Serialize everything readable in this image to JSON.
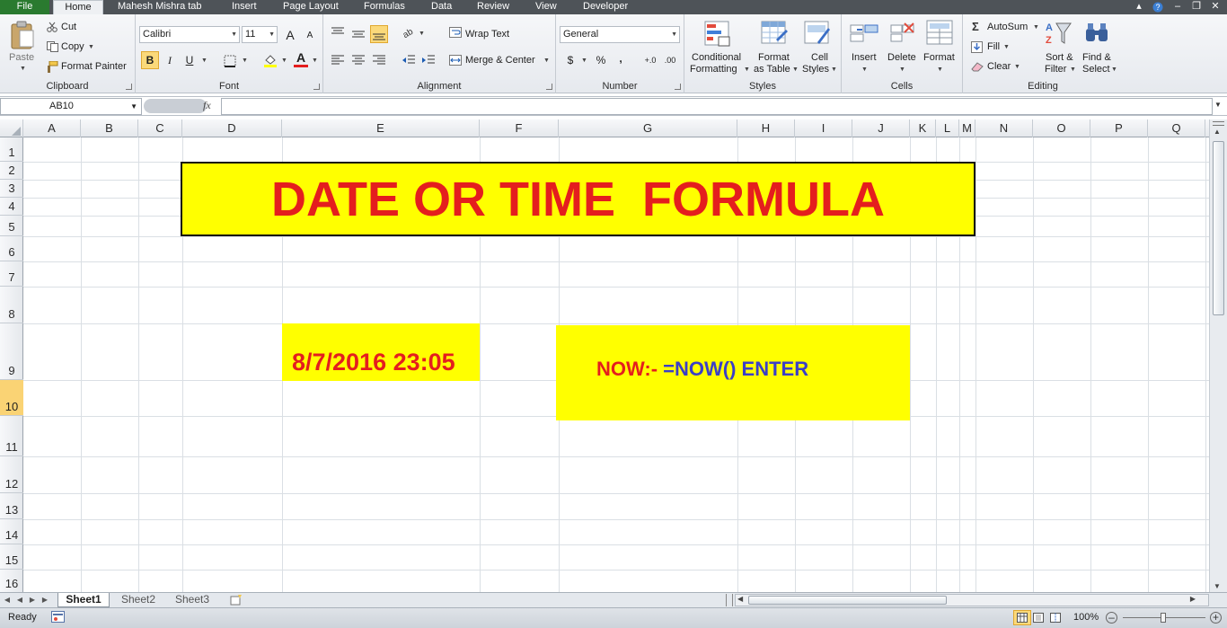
{
  "ribbon_tabs": [
    "File",
    "Home",
    "Mahesh Mishra tab",
    "Insert",
    "Page Layout",
    "Formulas",
    "Data",
    "Review",
    "View",
    "Developer"
  ],
  "clipboard": {
    "paste": "Paste",
    "cut": "Cut",
    "copy": "Copy",
    "format_painter": "Format Painter",
    "label": "Clipboard"
  },
  "font": {
    "name": "Calibri",
    "size": "11",
    "bold": "B",
    "italic": "I",
    "underline": "U",
    "grow": "A",
    "shrink": "A",
    "font_color_glyph": "A",
    "label": "Font",
    "font_color": "#e41e1e",
    "fill_color": "#ffff00"
  },
  "alignment": {
    "wrap_text": "Wrap Text",
    "merge_center": "Merge & Center",
    "label": "Alignment"
  },
  "number": {
    "format": "General",
    "currency": "$",
    "percent": "%",
    "comma": ",",
    "inc_decimal": "+.0",
    "dec_decimal": ".00",
    "label": "Number"
  },
  "styles": {
    "conditional_1": "Conditional",
    "conditional_2": "Formatting",
    "format_table_1": "Format",
    "format_table_2": "as Table",
    "cell_styles_1": "Cell",
    "cell_styles_2": "Styles",
    "label": "Styles"
  },
  "cells": {
    "insert": "Insert",
    "delete": "Delete",
    "format": "Format",
    "label": "Cells"
  },
  "editing": {
    "autosum": "AutoSum",
    "fill": "Fill",
    "clear": "Clear",
    "sort_1": "Sort &",
    "sort_2": "Filter",
    "find_1": "Find &",
    "find_2": "Select",
    "sigma": "Σ",
    "label": "Editing"
  },
  "formula_bar": {
    "name_box": "AB10",
    "fx": "fx",
    "value": ""
  },
  "columns": [
    "A",
    "B",
    "C",
    "D",
    "E",
    "F",
    "G",
    "H",
    "I",
    "J",
    "K",
    "L",
    "M",
    "N",
    "O",
    "P",
    "Q"
  ],
  "rows": [
    "1",
    "2",
    "3",
    "4",
    "5",
    "6",
    "7",
    "8",
    "9",
    "10",
    "11",
    "12",
    "13",
    "14",
    "15",
    "16"
  ],
  "selected_row": "10",
  "content": {
    "title": "DATE OR TIME  FORMULA",
    "date_value": "8/7/2016 23:05",
    "now_label": "NOW:-",
    "now_formula": "=NOW() ENTER"
  },
  "sheets": [
    "Sheet1",
    "Sheet2",
    "Sheet3"
  ],
  "active_sheet": "Sheet1",
  "status": {
    "ready": "Ready",
    "zoom": "100%"
  },
  "colors": {
    "highlight_yellow": "#ffff00",
    "title_red": "#e41e1e",
    "formula_blue": "#3b3fc7",
    "file_tab_green": "#2a7a2f"
  }
}
